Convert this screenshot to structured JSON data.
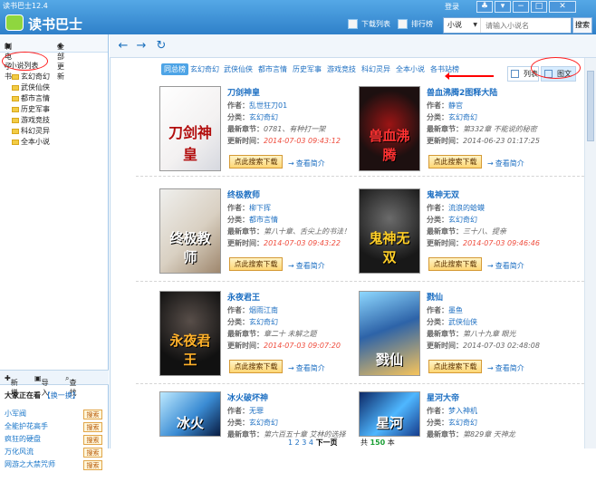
{
  "window": {
    "title": "读书巴士12.4",
    "logo_text": "读书巴士"
  },
  "top": {
    "login": "登录",
    "download_list": "下载列表",
    "rank": "排行榜",
    "search_type": "小说",
    "search_placeholder": "请输入小说名",
    "search_button": "搜索"
  },
  "sidebar": {
    "make_ebook": "制电子书",
    "update_all": "全部更新",
    "root": "小说列表",
    "categories": [
      "玄幻奇幻",
      "武侠仙侠",
      "都市言情",
      "历史军事",
      "游戏竞技",
      "科幻灵异",
      "全本小说"
    ],
    "tools": [
      "新增",
      "导入",
      "查找"
    ],
    "reading_title": "大家正在看",
    "reading_swap": "【换一换】",
    "reading": [
      {
        "name": "小军阀",
        "btn": "搜索"
      },
      {
        "name": "全能护花高手",
        "btn": "搜索"
      },
      {
        "name": "疯狂的硬盘",
        "btn": "搜索"
      },
      {
        "name": "万化风流",
        "btn": "搜索"
      },
      {
        "name": "网游之大禁咒师",
        "btn": "搜索"
      }
    ]
  },
  "main": {
    "categories": [
      "同总榜",
      "玄幻奇幻",
      "武侠仙侠",
      "都市言情",
      "历史军事",
      "游戏竞技",
      "科幻灵异",
      "全本小说",
      "各书站榜"
    ],
    "view_list": "列表",
    "view_grid": "图文",
    "labels": {
      "author": "作者：",
      "category": "分类：",
      "latest": "最新章节：",
      "updated": "更新时间：",
      "download": "点此搜索下载",
      "brief": "查看简介"
    },
    "books": [
      {
        "title": "刀剑神皇",
        "author": "乱世狂刀01",
        "category": "玄幻奇幻",
        "latest": "0781、有种打一架",
        "updated": "2014-07-03 09:43:12",
        "cover": "刀剑神皇"
      },
      {
        "title": "兽血沸腾2图释大陆",
        "author": "静官",
        "category": "玄幻奇幻",
        "latest": "第332章 不能说的秘密",
        "updated": "2014-06-23 01:17:25",
        "cover": "兽血沸腾"
      },
      {
        "title": "终极教师",
        "author": "柳下挥",
        "category": "都市言情",
        "latest": "第八十章、舌尖上的书法！",
        "updated": "2014-07-03 09:43:22",
        "cover": "终极教师"
      },
      {
        "title": "鬼神无双",
        "author": "流浪的蛤蟆",
        "category": "玄幻奇幻",
        "latest": "三十八、提亲",
        "updated": "2014-07-03 09:46:46",
        "cover": "鬼神无双"
      },
      {
        "title": "永夜君王",
        "author": "烟雨江南",
        "category": "玄幻奇幻",
        "latest": "章二十 未解之题",
        "updated": "2014-07-03 09:07:20",
        "cover": "永夜君王"
      },
      {
        "title": "戮仙",
        "author": "墨鱼",
        "category": "武侠仙侠",
        "latest": "第八十九章 眼光",
        "updated": "2014-07-03 02:48:08",
        "cover": "戮仙"
      },
      {
        "title": "冰火破坏神",
        "author": "无罪",
        "category": "玄幻奇幻",
        "latest": "第六百五十章 艾林的选择",
        "updated": "",
        "cover": "冰火"
      },
      {
        "title": "星河大帝",
        "author": "梦入神机",
        "category": "玄幻奇幻",
        "latest": "第829章 天神龙",
        "updated": "",
        "cover": "星河"
      }
    ],
    "pager": {
      "pages": [
        "1",
        "2",
        "3",
        "4"
      ],
      "next": "下一页",
      "total_prefix": "共",
      "total": "150",
      "total_suffix": "本"
    }
  }
}
